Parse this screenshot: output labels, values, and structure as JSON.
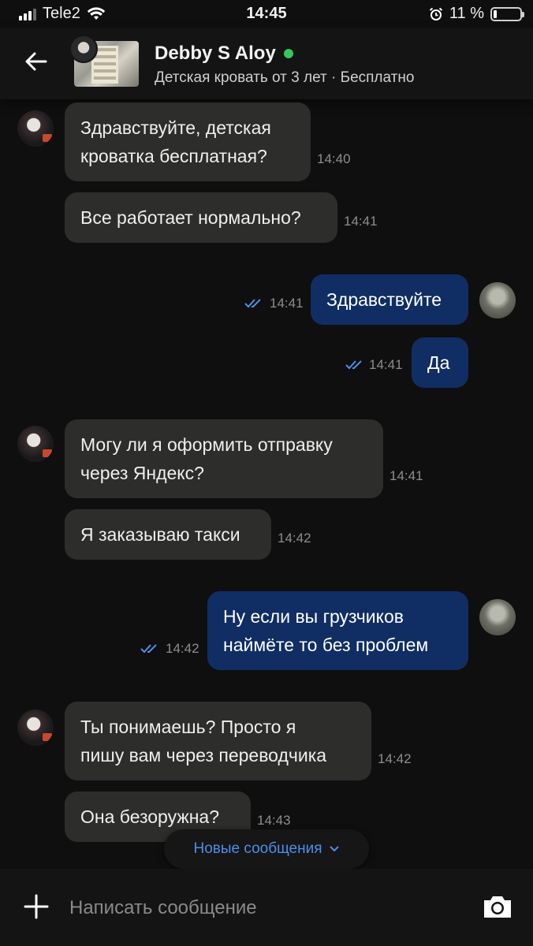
{
  "status": {
    "carrier": "Tele2",
    "time": "14:45",
    "battery": "11 %",
    "battery_level": 0.11
  },
  "header": {
    "name": "Debby S Aloy",
    "listing": "Детская кровать от 3 лет · Бесплатно",
    "online_color": "#34c759"
  },
  "messages": [
    {
      "dir": "in",
      "lines": [
        "Здравствуйте, детская",
        "кроватка бесплатная?"
      ],
      "time": "14:40"
    },
    {
      "dir": "in",
      "lines": [
        "Все работает нормально?"
      ],
      "time": "14:41"
    },
    {
      "dir": "out",
      "lines": [
        "Здравствуйте"
      ],
      "time": "14:41"
    },
    {
      "dir": "out",
      "lines": [
        "Да"
      ],
      "time": "14:41"
    },
    {
      "dir": "in",
      "lines": [
        "Могу ли я оформить отправку",
        "через Яндекс?"
      ],
      "time": "14:41"
    },
    {
      "dir": "in",
      "lines": [
        "Я заказываю такси"
      ],
      "time": "14:42"
    },
    {
      "dir": "out",
      "lines": [
        "Ну если вы грузчиков",
        "наймёте то без проблем"
      ],
      "time": "14:42"
    },
    {
      "dir": "in",
      "lines": [
        "Ты понимаешь? Просто я",
        "пишу вам через переводчика"
      ],
      "time": "14:42"
    },
    {
      "dir": "in",
      "lines": [
        "Она безоружна?"
      ],
      "time": "14:43"
    }
  ],
  "new_messages_label": "Новые сообщения",
  "input": {
    "placeholder": "Написать сообщение"
  },
  "colors": {
    "incoming_bubble": "#2d2d2b",
    "outgoing_bubble": "#102e63",
    "read_ticks": "#4d8fe8",
    "accent": "#4d8fe8"
  },
  "icons": [
    "back-arrow-icon",
    "online-dot-icon",
    "read-ticks-icon",
    "chevron-down-icon",
    "plus-icon",
    "camera-icon",
    "wifi-icon",
    "alarm-icon",
    "battery-icon",
    "signal-icon"
  ]
}
